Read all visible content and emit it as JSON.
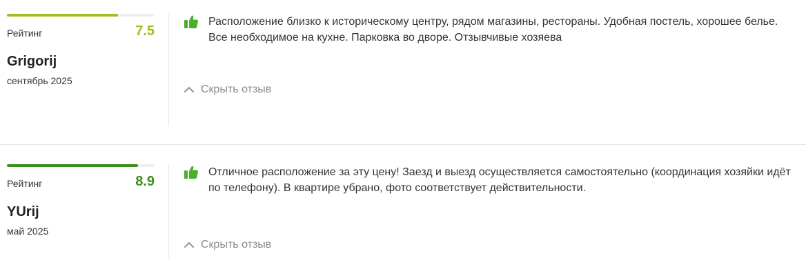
{
  "colors": {
    "rating_mid": "#a8b920",
    "rating_high": "#3d8f17",
    "thumb_green": "#4caf2a"
  },
  "reviews": [
    {
      "rating_label": "Рейтинг",
      "rating": "7.5",
      "rating_fraction": 0.75,
      "author": "Grigorij",
      "date": "сентябрь 2025",
      "positive_icon": "thumbs-up-icon",
      "text": "Расположение близко к историческому центру, рядом магазины, рестораны. Удобная постель, хорошее белье. Все необходимое на кухне. Парковка во дворе. Отзывчивые хозяева",
      "toggle_label": "Скрыть отзыв"
    },
    {
      "rating_label": "Рейтинг",
      "rating": "8.9",
      "rating_fraction": 0.89,
      "author": "YUrij",
      "date": "май 2025",
      "positive_icon": "thumbs-up-icon",
      "text": "Отличное расположение за эту цену! Заезд и выезд осуществляется самостоятельно (координация хозяйки идёт по телефону). В квартире убрано, фото соответствует действительности.",
      "toggle_label": "Скрыть отзыв"
    }
  ]
}
